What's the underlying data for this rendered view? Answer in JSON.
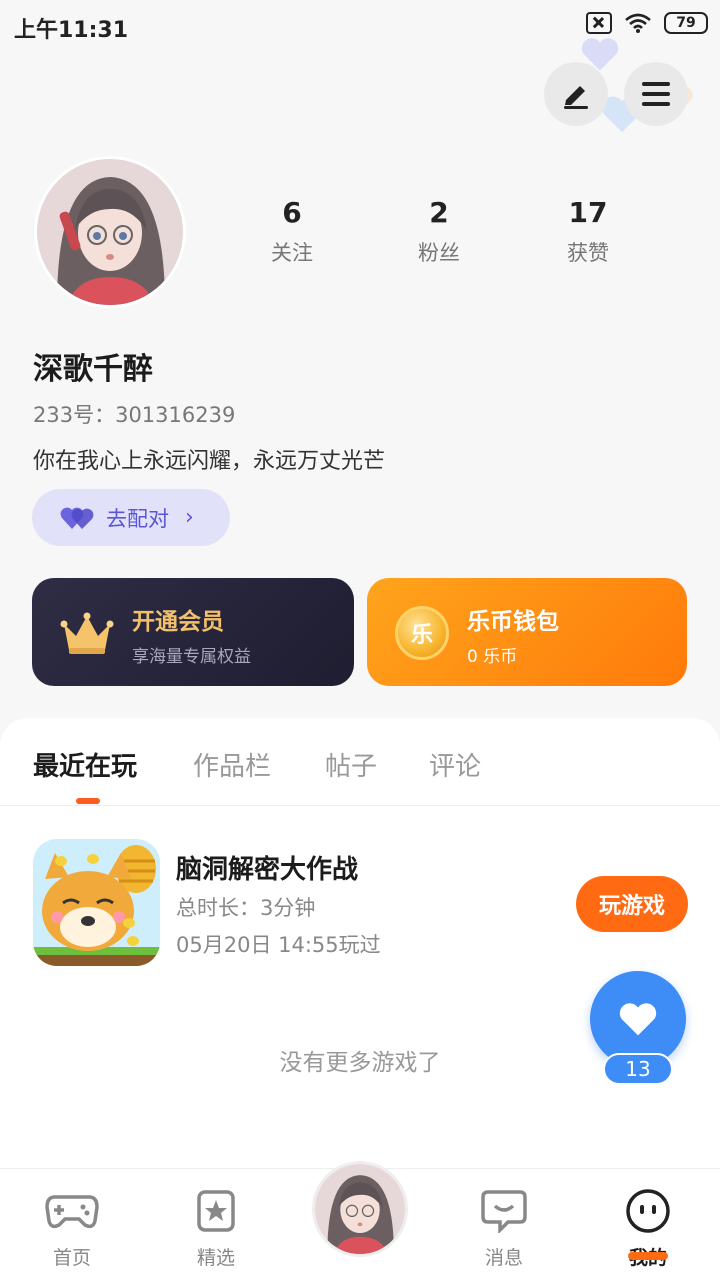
{
  "status_bar": {
    "time": "上午11:31",
    "battery": "79"
  },
  "profile": {
    "stats": [
      {
        "value": "6",
        "label": "关注"
      },
      {
        "value": "2",
        "label": "粉丝"
      },
      {
        "value": "17",
        "label": "获赞"
      }
    ],
    "username": "深歌千醉",
    "user_id": "233号：301316239",
    "bio": "你在我心上永远闪耀，永远万丈光芒",
    "match_button": "去配对"
  },
  "cards": {
    "vip": {
      "title": "开通会员",
      "subtitle": "享海量专属权益"
    },
    "wallet": {
      "title": "乐币钱包",
      "subtitle": "0 乐币",
      "coin_glyph": "乐"
    }
  },
  "tabs": [
    "最近在玩",
    "作品栏",
    "帖子",
    "评论"
  ],
  "recent_game": {
    "title": "脑洞解密大作战",
    "duration": "总时长：3分钟",
    "last_played": "05月20日 14:55玩过",
    "play_button": "玩游戏"
  },
  "empty_hint": "没有更多游戏了",
  "floating_like": {
    "count": "13"
  },
  "bottom_nav": [
    {
      "label": "首页",
      "icon": "gamepad-icon"
    },
    {
      "label": "精选",
      "icon": "star-card-icon"
    },
    {
      "label": "",
      "icon": "avatar-center"
    },
    {
      "label": "消息",
      "icon": "chat-icon"
    },
    {
      "label": "我的",
      "icon": "face-icon"
    }
  ],
  "colors": {
    "accent": "#ff6a13",
    "match": "#5a55d6",
    "like": "#3e8cf5"
  }
}
